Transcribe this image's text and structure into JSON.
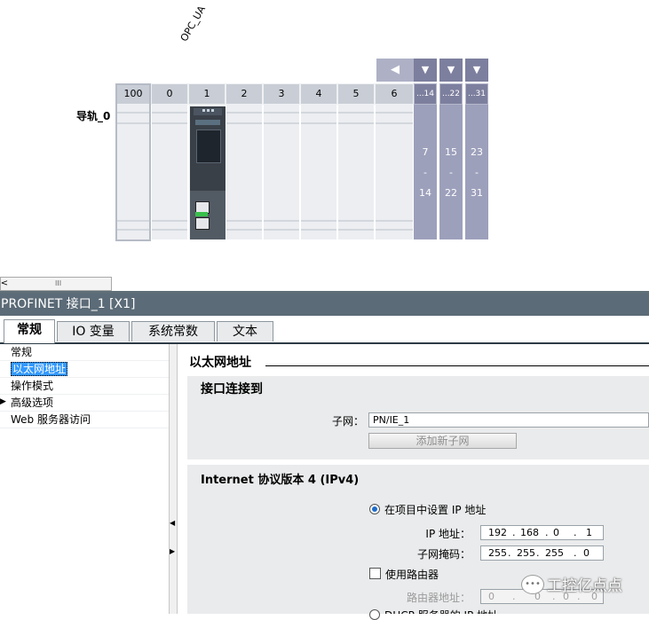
{
  "rack": {
    "device_label": "OPC_UA",
    "rail_label": "导轨_0",
    "slots": [
      "100",
      "0",
      "1",
      "2",
      "3",
      "4",
      "5",
      "6"
    ],
    "nav_left_icon": "triangle-left-icon",
    "expand_icon": "triangle-down-icon",
    "ranges": [
      {
        "head": "...14",
        "from": "7",
        "sep": "-",
        "to": "14"
      },
      {
        "head": "...22",
        "from": "15",
        "sep": "-",
        "to": "22"
      },
      {
        "head": "...31",
        "from": "23",
        "sep": "-",
        "to": "31"
      }
    ]
  },
  "scrollbar": {
    "grip": "III",
    "arrow": "<"
  },
  "panel": {
    "title": "PROFINET 接口_1 [X1]",
    "tabs": [
      "常规",
      "IO 变量",
      "系统常数",
      "文本"
    ],
    "nav": [
      "常规",
      "以太网地址",
      "操作模式",
      "高级选项",
      "Web 服务器访问"
    ],
    "section_title": "以太网地址",
    "interface_group": {
      "title": "接口连接到",
      "subnet_label": "子网：",
      "subnet_value": "PN/IE_1",
      "add_subnet_button": "添加新子网"
    },
    "ipv4_group": {
      "title": "Internet 协议版本 4 (IPv4)",
      "radio_project": "在项目中设置 IP 地址",
      "ip_label": "IP 地址：",
      "ip_octets": [
        "192",
        "168",
        "0",
        "1"
      ],
      "mask_label": "子网掩码：",
      "mask_octets": [
        "255",
        "255",
        "255",
        "0"
      ],
      "use_router_label": "使用路由器",
      "router_label": "路由器地址：",
      "router_octets": [
        "0",
        "0",
        "0",
        "0"
      ],
      "radio_dhcp": "DHCP 服务器的 IP 地址"
    }
  },
  "watermark": "工控亿点点"
}
